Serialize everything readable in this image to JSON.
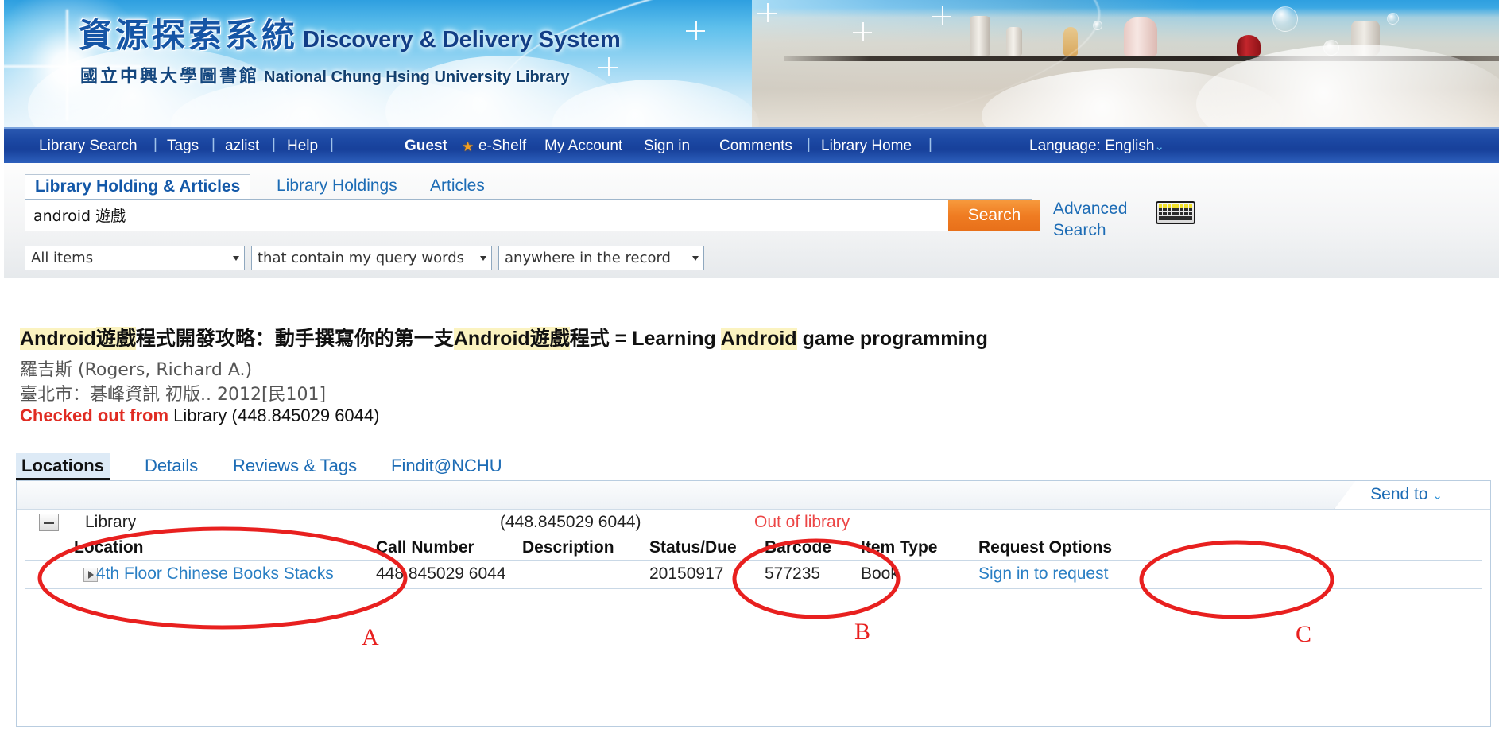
{
  "banner": {
    "title_cn": "資源探索系統",
    "title_en": "Discovery & Delivery System",
    "subtitle_cn": "國立中興大學圖書館",
    "subtitle_en": "National Chung Hsing University Library"
  },
  "nav": {
    "items": [
      {
        "label": "Library Search",
        "bold": false
      },
      {
        "label": "Tags",
        "bold": false
      },
      {
        "label": "azlist",
        "bold": false
      },
      {
        "label": "Help",
        "bold": false
      },
      {
        "label": "Guest",
        "bold": true
      },
      {
        "label": "e-Shelf",
        "bold": false
      },
      {
        "label": "My Account",
        "bold": false
      },
      {
        "label": "Sign in",
        "bold": false
      },
      {
        "label": "Comments",
        "bold": false
      },
      {
        "label": "Library Home",
        "bold": false
      }
    ],
    "star_icon": "star-icon",
    "language_label": "Language: English",
    "language_caret": "⌄"
  },
  "search": {
    "tabs": [
      {
        "label": "Library Holding & Articles",
        "active": true
      },
      {
        "label": "Library Holdings",
        "active": false
      },
      {
        "label": "Articles",
        "active": false
      }
    ],
    "query": "android 遊戲",
    "placeholder": "",
    "search_button": "Search",
    "advanced_link": "Advanced Search",
    "keyboard_icon": "keyboard-icon",
    "filters": [
      {
        "value": "All items"
      },
      {
        "value": "that contain my query words"
      },
      {
        "value": "anywhere in the record"
      }
    ]
  },
  "record": {
    "title_parts": [
      {
        "text": "Android",
        "highlight": true,
        "cjk": false
      },
      {
        "text": "遊戲",
        "highlight": true,
        "cjk": true
      },
      {
        "text": "程式開發攻略：動手撰寫你的第一支",
        "highlight": false,
        "cjk": true
      },
      {
        "text": "Android",
        "highlight": true,
        "cjk": false
      },
      {
        "text": "遊戲",
        "highlight": true,
        "cjk": true
      },
      {
        "text": "程式",
        "highlight": false,
        "cjk": true
      },
      {
        "text": " = Learning ",
        "highlight": false,
        "cjk": false
      },
      {
        "text": "Android",
        "highlight": true,
        "cjk": false
      },
      {
        "text": " game programming",
        "highlight": false,
        "cjk": false
      }
    ],
    "title_plain": "Android遊戲程式開發攻略：動手撰寫你的第一支Android遊戲程式 = Learning Android game programming",
    "author": "羅吉斯 (Rogers, Richard A.)",
    "publication": "臺北市：碁峰資訊 初版.. 2012[民101]",
    "status_label": "Checked out from",
    "status_location": "Library",
    "status_call_number": "(448.845029 6044)"
  },
  "detail_tabs": [
    {
      "label": "Locations",
      "active": true
    },
    {
      "label": "Details",
      "active": false
    },
    {
      "label": "Reviews & Tags",
      "active": false
    },
    {
      "label": "Findit@NCHU",
      "active": false
    }
  ],
  "holdings": {
    "send_to_label": "Send to",
    "send_to_caret": "⌄",
    "collapse_icon": "minus-icon",
    "library_name": "Library",
    "library_call_number": "(448.845029 6044)",
    "library_status": "Out of library",
    "columns": [
      "Location",
      "Call Number",
      "Description",
      "Status/Due",
      "Barcode",
      "Item Type",
      "Request Options"
    ],
    "rows": [
      {
        "expand_icon": "triangle-right-icon",
        "location": "4th Floor Chinese Books Stacks",
        "call_number": "448.845029 6044",
        "description": "",
        "status_due": "20150917",
        "barcode": "577235",
        "item_type": "Book",
        "request_options": "Sign in to request"
      }
    ]
  },
  "annotations": [
    {
      "letter": "A",
      "target": "location-column"
    },
    {
      "letter": "B",
      "target": "status-due-column"
    },
    {
      "letter": "C",
      "target": "request-options-column"
    }
  ],
  "colors": {
    "nav_blue": "#1d4aa5",
    "link_blue": "#1d6cb5",
    "accent_orange": "#ef7c22",
    "status_red": "#e02b22",
    "annotation_red": "#e8201f",
    "highlight_yellow": "#fbf3c0"
  }
}
